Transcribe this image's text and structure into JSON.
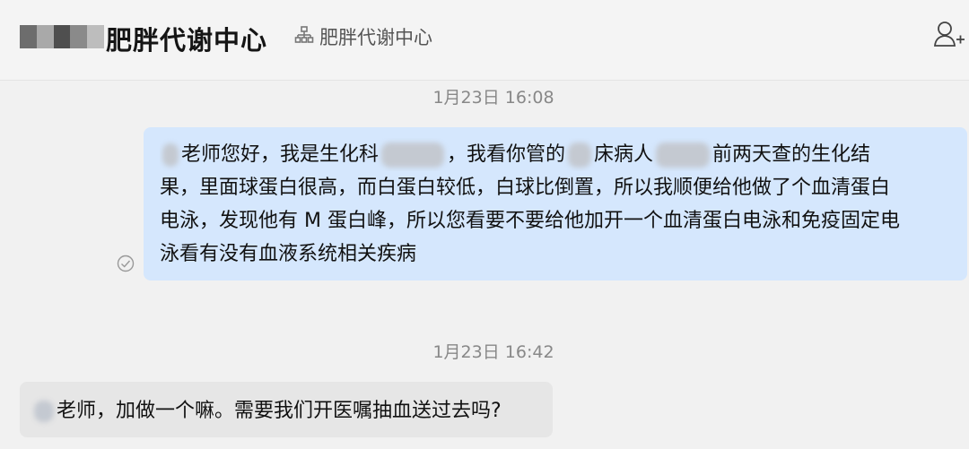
{
  "header": {
    "title": "肥胖代谢中心",
    "subtitle": "肥胖代谢中心",
    "org_icon": "org-chart-icon",
    "add_icon": "add-user-icon"
  },
  "messages": [
    {
      "timestamp": "1月23日 16:08",
      "direction": "outgoing",
      "lines": [
        [
          "老师您好，我是生化科",
          "，我看你管的",
          "床病人",
          "前两天查的生化结"
        ],
        [
          "果，里面球蛋白很高，而白蛋白较低，白球比倒置，所以我顺便给他做了个血清蛋白"
        ],
        [
          "电泳，发现他有 M 蛋白峰，所以您看要不要给他加开一个血清蛋白电泳和免疫固定电"
        ],
        [
          "泳看有没有血液系统相关疾病"
        ]
      ],
      "status_icon": "read-check-icon"
    },
    {
      "timestamp": "1月23日 16:42",
      "direction": "incoming",
      "text": "老师，加做一个嘛。需要我们开医嘱抽血送过去吗?"
    }
  ],
  "colors": {
    "background": "#f1f1f1",
    "outgoing_bubble": "#d5e7fd",
    "incoming_bubble": "#e6e6e6",
    "timestamp": "#888888"
  }
}
